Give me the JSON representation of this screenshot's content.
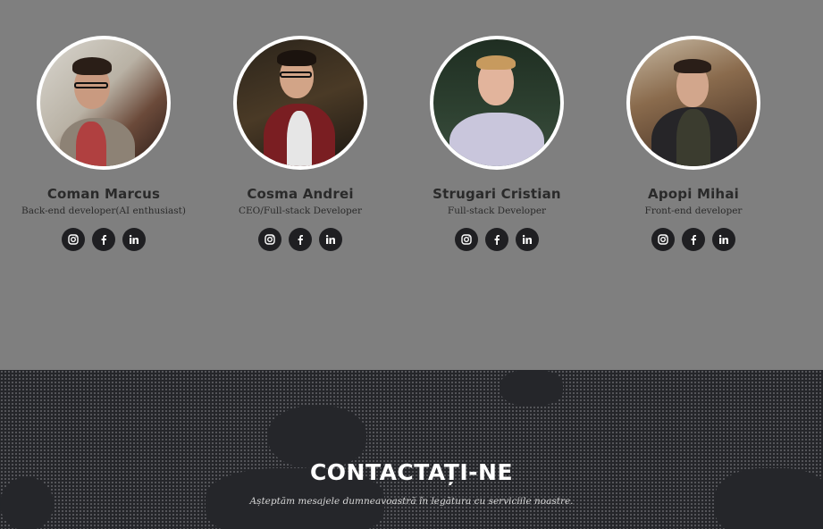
{
  "team": {
    "members": [
      {
        "name": "Coman Marcus",
        "role": "Back-end developer(AI enthusiast)",
        "socials": [
          "instagram-icon",
          "facebook-icon",
          "linkedin-icon"
        ]
      },
      {
        "name": "Cosma Andrei",
        "role": "CEO/Full-stack Developer",
        "socials": [
          "instagram-icon",
          "facebook-icon",
          "linkedin-icon"
        ]
      },
      {
        "name": "Strugari Cristian",
        "role": "Full-stack Developer",
        "socials": [
          "instagram-icon",
          "facebook-icon",
          "linkedin-icon"
        ]
      },
      {
        "name": "Apopi Mihai",
        "role": "Front-end developer",
        "socials": [
          "instagram-icon",
          "facebook-icon",
          "linkedin-icon"
        ]
      }
    ]
  },
  "contact": {
    "title": "CONTACTAȚI-NE",
    "subtitle": "Așteptăm mesajele dumneavoastră în legătura cu serviciile noastre."
  },
  "colors": {
    "team_bg": "#7f7f7f",
    "contact_bg": "#25262a",
    "social_bg": "#1f1f22"
  }
}
